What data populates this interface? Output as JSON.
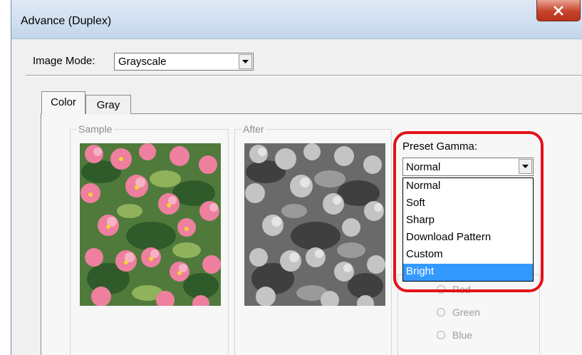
{
  "window": {
    "title": "Advance (Duplex)",
    "close_glyph": "✕"
  },
  "image_mode": {
    "label": "Image Mode:",
    "value": "Grayscale"
  },
  "tabs": [
    {
      "label": "Color",
      "active": true
    },
    {
      "label": "Gray",
      "active": false
    }
  ],
  "groups": {
    "sample": "Sample",
    "after": "After"
  },
  "gamma": {
    "label": "Preset Gamma:",
    "value": "Normal",
    "options": [
      "Normal",
      "Soft",
      "Sharp",
      "Download Pattern",
      "Custom",
      "Bright"
    ],
    "selected_index": 5
  },
  "color_radios": {
    "red": "Red",
    "green": "Green",
    "blue": "Blue"
  },
  "colors": {
    "highlight": "#e3111a",
    "selection": "#3399ff"
  }
}
